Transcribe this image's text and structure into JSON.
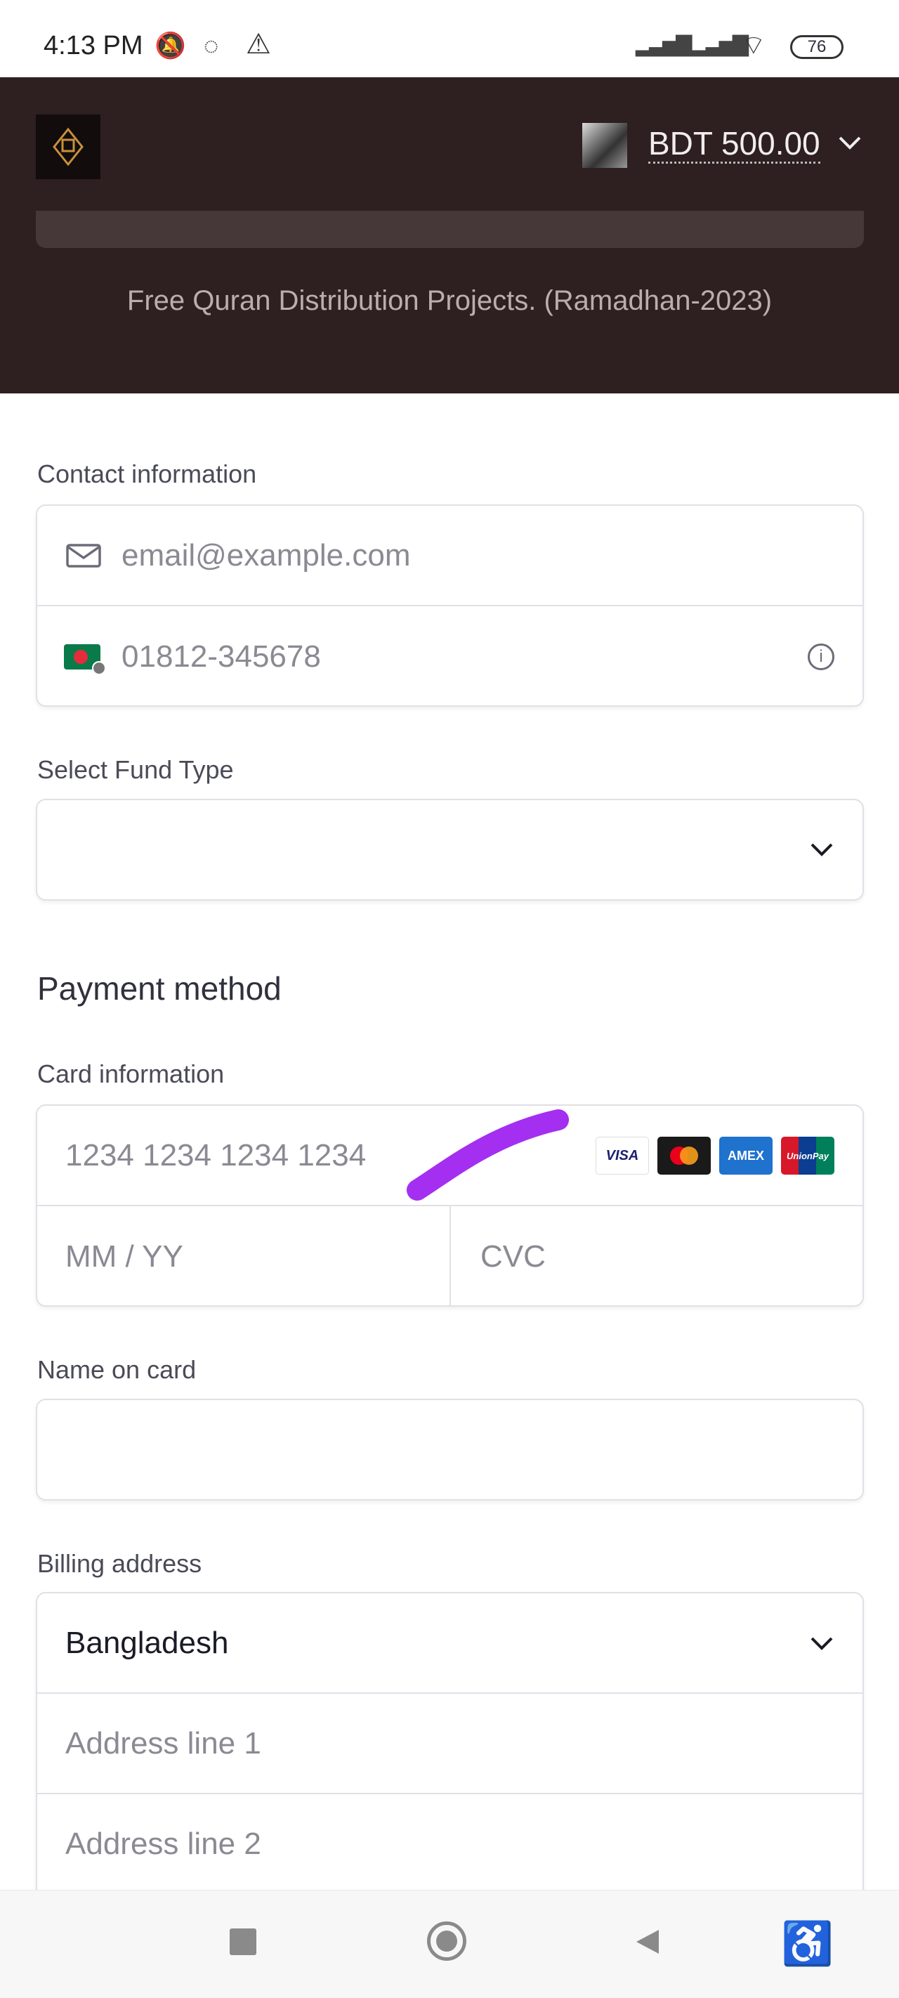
{
  "status_bar": {
    "time": "4:13 PM",
    "battery": "76"
  },
  "header": {
    "amount": "BDT 500.00",
    "subtitle": "Free Quran Distribution Projects. (Ramadhan-2023)"
  },
  "contact": {
    "label": "Contact information",
    "email_placeholder": "email@example.com",
    "phone_placeholder": "01812-345678"
  },
  "fund": {
    "label": "Select Fund Type",
    "value": ""
  },
  "payment": {
    "heading": "Payment method",
    "card_label": "Card information",
    "card_number_placeholder": "1234 1234 1234 1234",
    "expiry_placeholder": "MM / YY",
    "cvc_placeholder": "CVC",
    "brands": [
      "VISA",
      "Mastercard",
      "AMEX",
      "UnionPay"
    ]
  },
  "name": {
    "label": "Name on card",
    "value": ""
  },
  "billing": {
    "label": "Billing address",
    "country": "Bangladesh",
    "line1_placeholder": "Address line 1",
    "line2_placeholder": "Address line 2"
  },
  "colors": {
    "header_bg": "#2e1f20",
    "annotation": "#a42ff0"
  }
}
